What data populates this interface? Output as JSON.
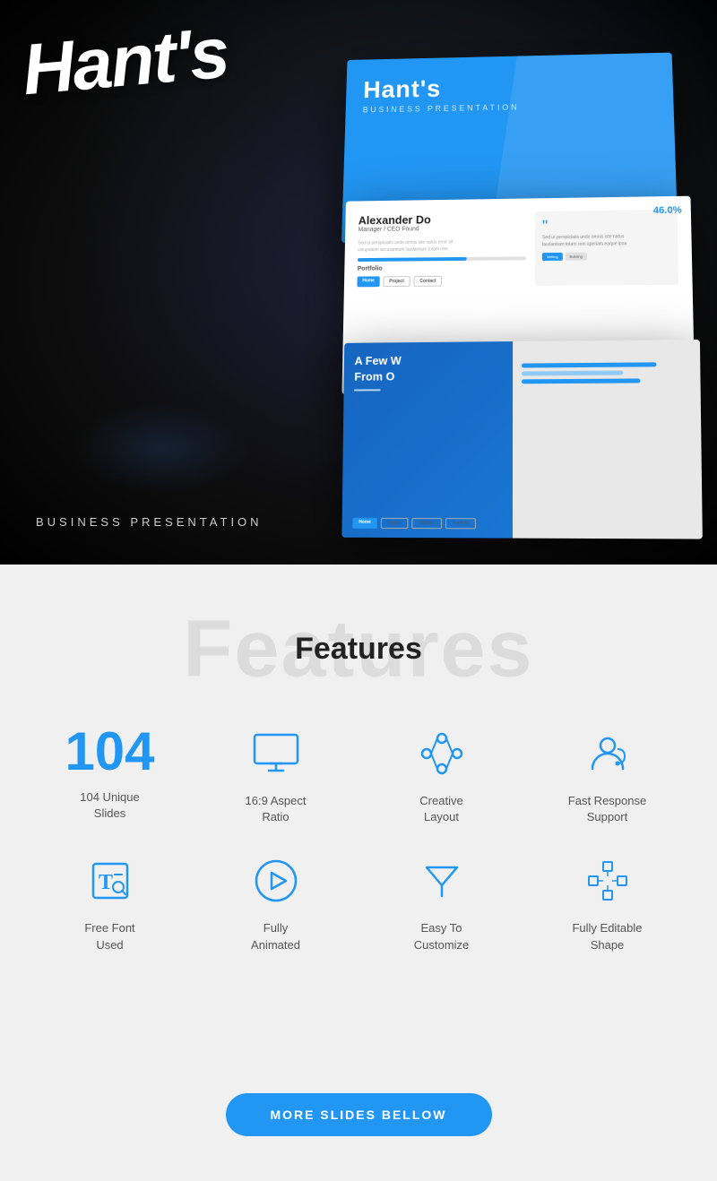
{
  "hero": {
    "title": "Hant's",
    "subtitle": "BUSINESS PRESENTATION",
    "slide_top_title": "Hant's",
    "slide_top_sub": "BUSINESS PRESENTATION",
    "slide_mid_name": "Alexander Do",
    "slide_mid_role": "Manager / CEO Found",
    "slide_mid_portfolio": "Portfolio",
    "slide_bot_text": "A Few W\nFrom O"
  },
  "features": {
    "bg_text": "Features",
    "title": "Features",
    "items": [
      {
        "id": "slides",
        "number": "104",
        "label": "104 Unique\nSlides",
        "icon": "number-icon"
      },
      {
        "id": "aspect",
        "number": "",
        "label": "16:9 Aspect\nRatio",
        "icon": "monitor-icon"
      },
      {
        "id": "layout",
        "number": "",
        "label": "Creative\nLayout",
        "icon": "nodes-icon"
      },
      {
        "id": "support",
        "number": "",
        "label": "Fast Response\nSupport",
        "icon": "support-icon"
      },
      {
        "id": "font",
        "number": "",
        "label": "Free Font\nUsed",
        "icon": "font-icon"
      },
      {
        "id": "animated",
        "number": "",
        "label": "Fully\nAnimated",
        "icon": "play-icon"
      },
      {
        "id": "customize",
        "number": "",
        "label": "Easy To\nCustomize",
        "icon": "filter-icon"
      },
      {
        "id": "editable",
        "number": "",
        "label": "Fully Editable\nShape",
        "icon": "shape-icon"
      }
    ]
  },
  "cta": {
    "button_label": "MORE SLIDES BELLOW"
  },
  "colors": {
    "accent": "#2196F3",
    "dark": "#1a1a2e",
    "text": "#555555"
  }
}
